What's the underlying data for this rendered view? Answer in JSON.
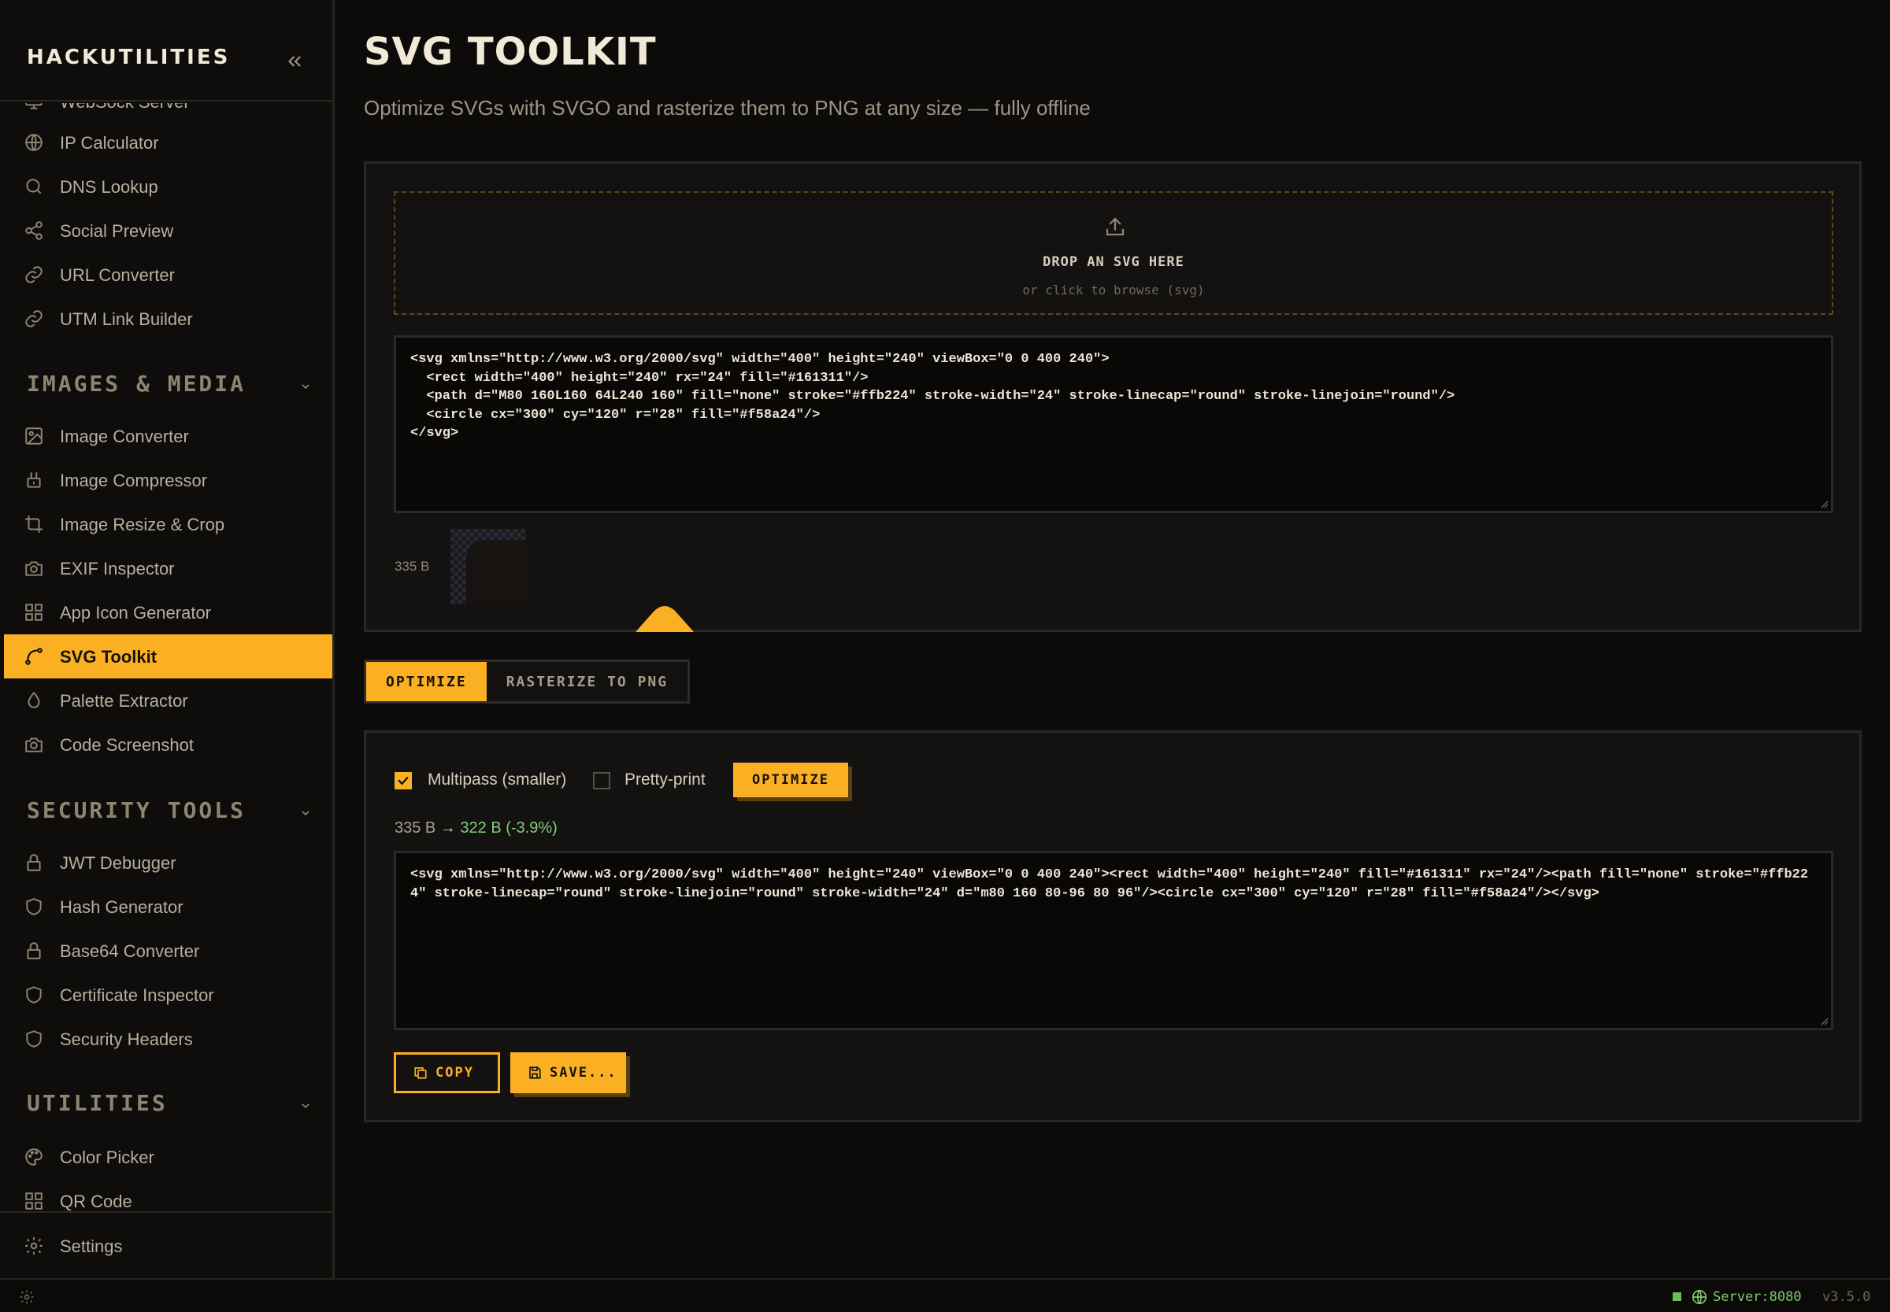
{
  "app": {
    "brand": "HACKUTILITIES",
    "page_title": "SVG TOOLKIT",
    "page_subtitle": "Optimize SVGs with SVGO and rasterize them to PNG at any size — fully offline"
  },
  "sidebar": {
    "partial_item": "WebSock Server",
    "items_top": [
      {
        "label": "IP Calculator",
        "icon": "globe-icon"
      },
      {
        "label": "DNS Lookup",
        "icon": "search-icon"
      },
      {
        "label": "Social Preview",
        "icon": "share-icon"
      },
      {
        "label": "URL Converter",
        "icon": "link-icon"
      },
      {
        "label": "UTM Link Builder",
        "icon": "link-icon"
      }
    ],
    "sections": [
      {
        "title": "IMAGES & MEDIA",
        "items": [
          {
            "label": "Image Converter",
            "icon": "image-icon"
          },
          {
            "label": "Image Compressor",
            "icon": "compress-icon"
          },
          {
            "label": "Image Resize & Crop",
            "icon": "crop-icon"
          },
          {
            "label": "EXIF Inspector",
            "icon": "camera-icon"
          },
          {
            "label": "App Icon Generator",
            "icon": "grid-icon"
          },
          {
            "label": "SVG Toolkit",
            "icon": "bezier-curve-icon",
            "active": true
          },
          {
            "label": "Palette Extractor",
            "icon": "droplet-icon"
          },
          {
            "label": "Code Screenshot",
            "icon": "camera-icon"
          }
        ]
      },
      {
        "title": "SECURITY TOOLS",
        "items": [
          {
            "label": "JWT Debugger",
            "icon": "lock-icon"
          },
          {
            "label": "Hash Generator",
            "icon": "shield-icon"
          },
          {
            "label": "Base64 Converter",
            "icon": "lock-icon"
          },
          {
            "label": "Certificate Inspector",
            "icon": "shield-icon"
          },
          {
            "label": "Security Headers",
            "icon": "shield-icon"
          }
        ]
      },
      {
        "title": "UTILITIES",
        "items": [
          {
            "label": "Color Picker",
            "icon": "palette-icon"
          },
          {
            "label": "QR Code",
            "icon": "grid-icon"
          }
        ]
      }
    ],
    "settings_label": "Settings"
  },
  "dropzone": {
    "title": "DROP AN SVG HERE",
    "subtitle": "or click to browse (svg)"
  },
  "input": {
    "code": "<svg xmlns=\"http://www.w3.org/2000/svg\" width=\"400\" height=\"240\" viewBox=\"0 0 400 240\">\n  <rect width=\"400\" height=\"240\" rx=\"24\" fill=\"#161311\"/>\n  <path d=\"M80 160L160 64L240 160\" fill=\"none\" stroke=\"#ffb224\" stroke-width=\"24\" stroke-linecap=\"round\" stroke-linejoin=\"round\"/>\n  <circle cx=\"300\" cy=\"120\" r=\"28\" fill=\"#f58a24\"/>\n</svg>",
    "size_label": "335 B"
  },
  "tabs": [
    {
      "label": "OPTIMIZE",
      "active": true
    },
    {
      "label": "RASTERIZE TO PNG",
      "active": false
    }
  ],
  "optimize": {
    "multipass_label": "Multipass (smaller)",
    "multipass_checked": true,
    "pretty_label": "Pretty-print",
    "pretty_checked": false,
    "button_label": "OPTIMIZE",
    "stats_before": "335 B",
    "stats_arrow": "→",
    "stats_after": "322 B (-3.9%)",
    "output_code": "<svg xmlns=\"http://www.w3.org/2000/svg\" width=\"400\" height=\"240\" viewBox=\"0 0 400 240\"><rect width=\"400\" height=\"240\" fill=\"#161311\" rx=\"24\"/><path fill=\"none\" stroke=\"#ffb224\" stroke-linecap=\"round\" stroke-linejoin=\"round\" stroke-width=\"24\" d=\"m80 160 80-96 80 96\"/><circle cx=\"300\" cy=\"120\" r=\"28\" fill=\"#f58a24\"/></svg>",
    "copy_label": "COPY",
    "save_label": "SAVE..."
  },
  "statusbar": {
    "server_label": "Server:8080",
    "version": "v3.5.0"
  },
  "colors": {
    "accent": "#fbb024",
    "success": "#7ed07a",
    "background": "#0c0b09",
    "panel": "#131210"
  }
}
